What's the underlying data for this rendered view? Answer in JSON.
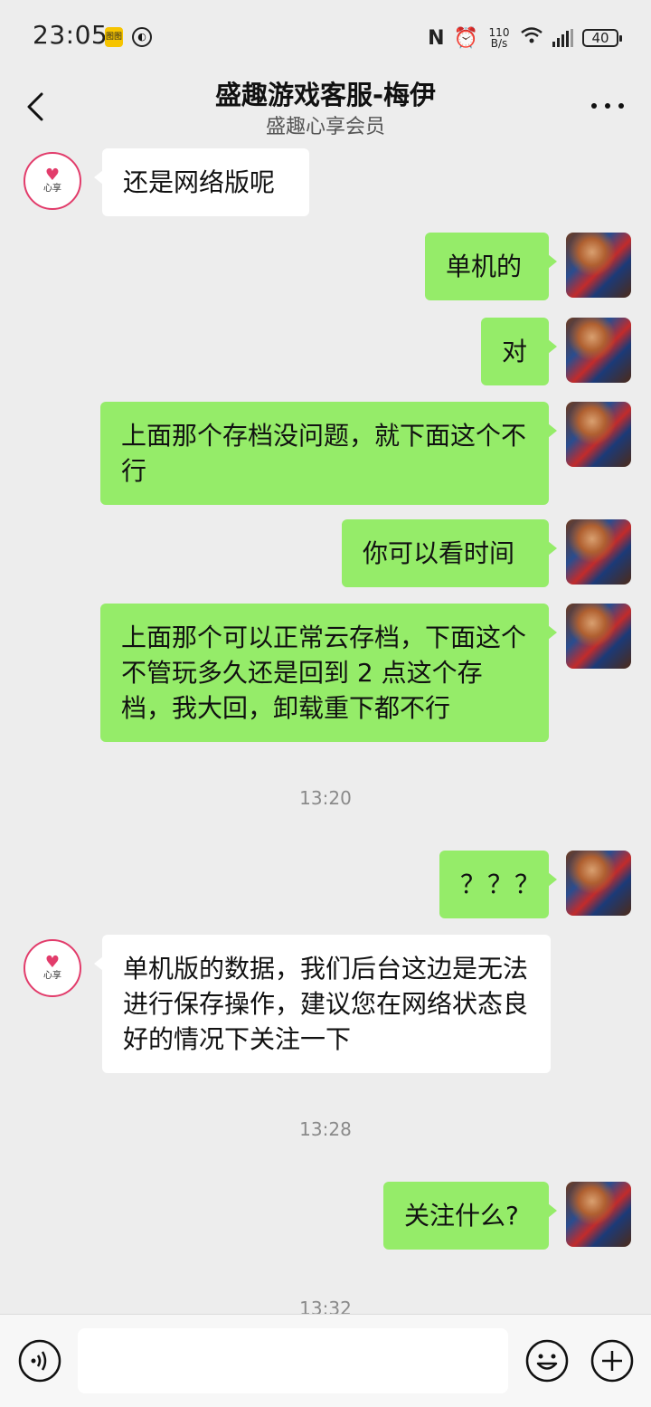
{
  "status_bar": {
    "time": "23:05",
    "app_icon_1": "图图",
    "app_icon_2": "◐",
    "nfc": "N",
    "alarm": "⏰",
    "speed_value": "110",
    "speed_unit": "B/s",
    "wifi": "◠",
    "battery": "40"
  },
  "header": {
    "title": "盛趣游戏客服-梅伊",
    "subtitle": "盛趣心享会员"
  },
  "service_avatar": {
    "heart": "♥",
    "label": "心享"
  },
  "messages": [
    {
      "side": "other",
      "text": "还是网络版呢"
    },
    {
      "side": "self",
      "text": "单机的"
    },
    {
      "side": "self",
      "text": "对"
    },
    {
      "side": "self",
      "text": "上面那个存档没问题，就下面这个不行"
    },
    {
      "side": "self",
      "text": "你可以看时间"
    },
    {
      "side": "self",
      "text": "上面那个可以正常云存档，下面这个不管玩多久还是回到 2 点这个存档，我大回，卸载重下都不行"
    },
    {
      "side": "time",
      "text": "13:20"
    },
    {
      "side": "self",
      "text": "？？？"
    },
    {
      "side": "other",
      "text": "单机版的数据，我们后台这边是无法进行保存操作，建议您在网络状态良好的情况下关注一下"
    },
    {
      "side": "time",
      "text": "13:28"
    },
    {
      "side": "self",
      "text": "关注什么?"
    },
    {
      "side": "time",
      "text": "13:32"
    }
  ],
  "input_bar": {
    "placeholder": ""
  }
}
